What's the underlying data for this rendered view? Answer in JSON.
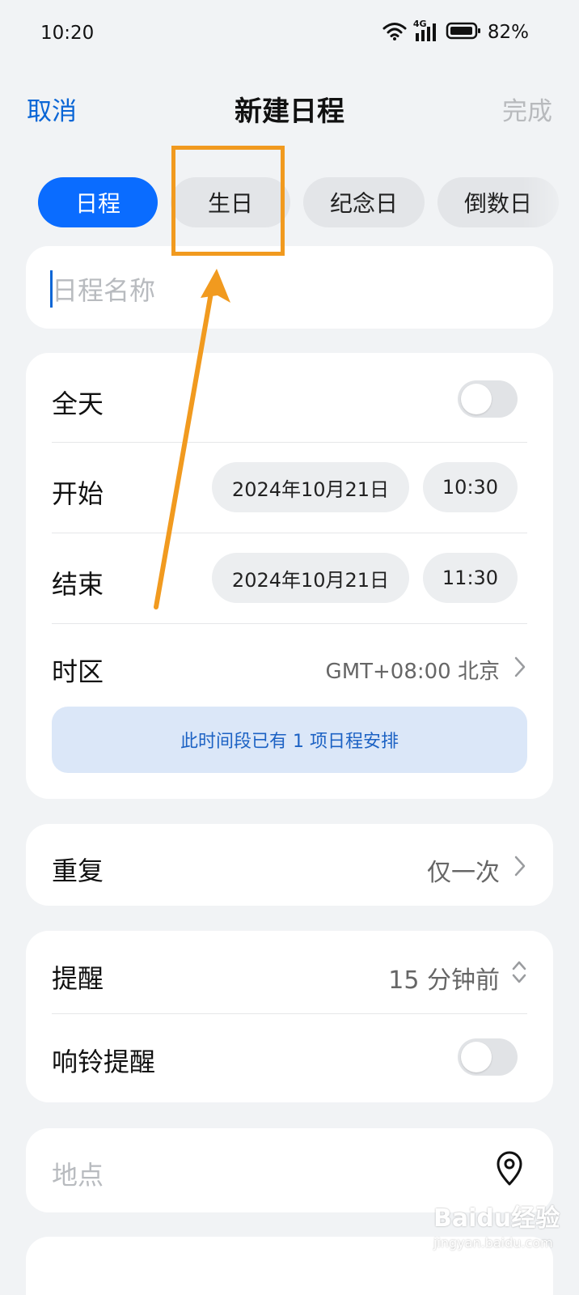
{
  "status_bar": {
    "time": "10:20",
    "network": "4G",
    "battery_percent": "82%"
  },
  "header": {
    "cancel_label": "取消",
    "title": "新建日程",
    "done_label": "完成"
  },
  "type_tabs": [
    {
      "label": "日程",
      "active": true
    },
    {
      "label": "生日",
      "active": false
    },
    {
      "label": "纪念日",
      "active": false
    },
    {
      "label": "倒数日",
      "active": false
    }
  ],
  "name_field": {
    "value": "",
    "placeholder": "日程名称"
  },
  "time_section": {
    "all_day": {
      "label": "全天",
      "on": false
    },
    "start": {
      "label": "开始",
      "date": "2024年10月21日",
      "time": "10:30"
    },
    "end": {
      "label": "结束",
      "date": "2024年10月21日",
      "time": "11:30"
    },
    "timezone": {
      "label": "时区",
      "value": "GMT+08:00 北京"
    },
    "conflict_notice": "此时间段已有 1 项日程安排"
  },
  "repeat": {
    "label": "重复",
    "value": "仅一次"
  },
  "reminder": {
    "label": "提醒",
    "value": "15 分钟前"
  },
  "ring_reminder": {
    "label": "响铃提醒",
    "on": false
  },
  "location": {
    "placeholder": "地点"
  },
  "watermark": {
    "text": "Baidu经验",
    "sub": "jingyan.baidu.com"
  },
  "colors": {
    "accent": "#0a6cff",
    "annotation": "#f19a1f",
    "notice_bg": "#dbe7f8"
  }
}
